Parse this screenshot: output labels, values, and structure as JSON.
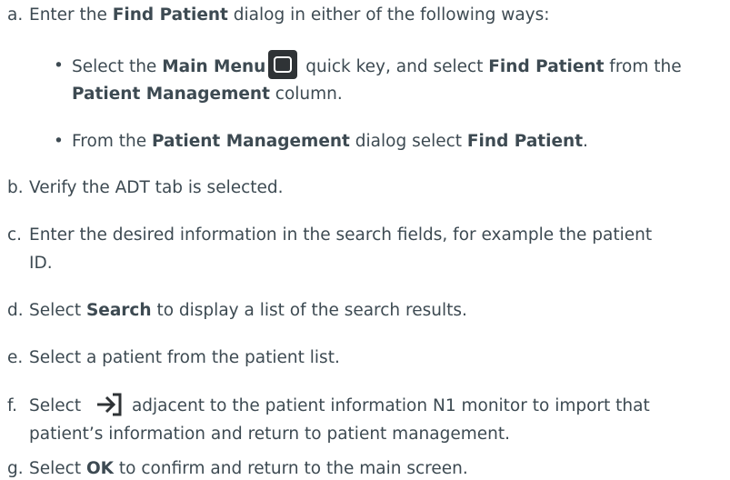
{
  "steps": [
    {
      "marker": "a.",
      "pre": "Enter the ",
      "b1": "Find Patient",
      "post": " dialog in either of the following ways:"
    },
    {
      "marker": "b.",
      "text": "Verify the ADT tab is selected."
    },
    {
      "marker": "c.",
      "line1": "Enter the desired information in the search fields, for example the patient",
      "line2": "ID."
    },
    {
      "marker": "d.",
      "pre": "Select ",
      "b1": "Search",
      "post": " to display a list of the search results."
    },
    {
      "marker": "e.",
      "text": "Select a patient from the patient list."
    },
    {
      "marker": "f.",
      "pre": "Select ",
      "post": "adjacent to the patient information N1 monitor to import that",
      "line2": "patient’s information and return to patient management."
    },
    {
      "marker": "g.",
      "pre": "Select ",
      "b1": "OK",
      "post": " to confirm and return to the main screen."
    }
  ],
  "substeps": [
    {
      "bullet": "•",
      "pre": "Select the ",
      "b1": "Main Menu",
      "mid": " quick key, and select ",
      "b2": "Find Patient",
      "post": " from the",
      "b3": "Patient Management",
      "post2": " column."
    },
    {
      "bullet": "•",
      "pre": "From the ",
      "b1": "Patient Management",
      "mid": " dialog select ",
      "b2": "Find Patient",
      "post": "."
    }
  ],
  "icons": {
    "main_menu": "main-menu-key-icon",
    "import": "import-arrow-icon"
  },
  "colors": {
    "text": "#3d4a52",
    "icon_dark": "#2f3336"
  }
}
